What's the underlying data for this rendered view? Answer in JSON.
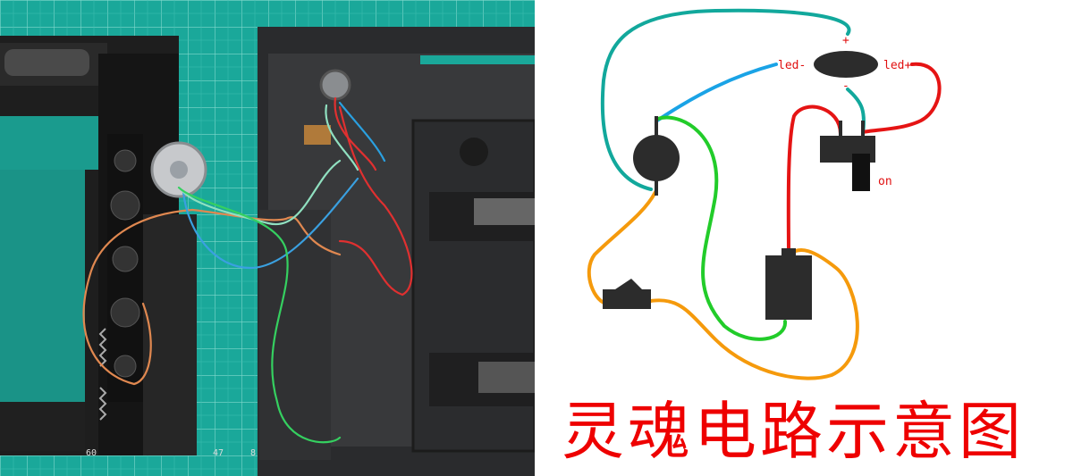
{
  "photo": {
    "ruler_marks": [
      "47",
      "8",
      "60"
    ],
    "mat_color": "#1aa89a",
    "grid_color": "#7fd8cc"
  },
  "diagram": {
    "labels": {
      "led_minus": "led-",
      "led_plus": "led+",
      "plus_sign": "+",
      "minus_sign": "-",
      "on": "on"
    },
    "wire_colors": {
      "teal": "#12a89c",
      "blue": "#1aa3e6",
      "red": "#e51414",
      "green": "#22cc2a",
      "orange": "#f59a0c"
    },
    "component_color": "#2c2c2c",
    "title": "灵魂电路示意图"
  }
}
